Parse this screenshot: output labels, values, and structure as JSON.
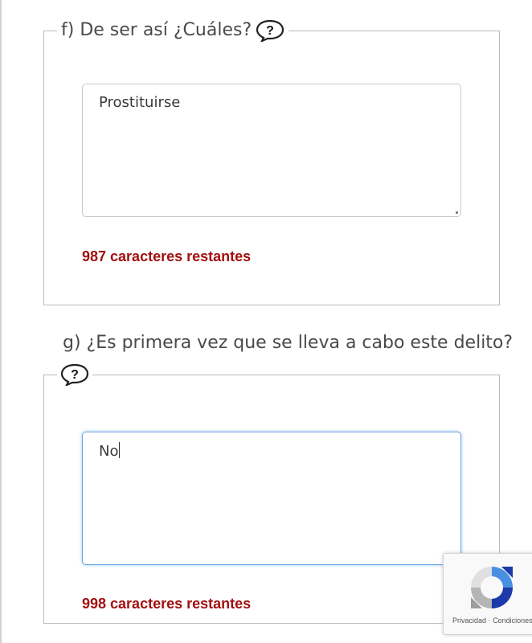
{
  "section_f": {
    "legend": "f) De ser así ¿Cuáles?",
    "answer": "Prostituirse",
    "counter": "987 caracteres restantes"
  },
  "section_g": {
    "question": "g) ¿Es primera vez que se lleva a cabo este delito?",
    "answer": "No",
    "counter": "998 caracteres restantes"
  },
  "recaptcha": {
    "privacy": "Privacidad",
    "separator": "·",
    "terms": "Condiciones"
  },
  "icons": {
    "help": "help-icon",
    "recaptcha": "recaptcha-logo-icon"
  },
  "colors": {
    "counter": "#a30f0f",
    "focus_border": "#6aa7e0",
    "recaptcha_blue": "#1c3aa9"
  }
}
